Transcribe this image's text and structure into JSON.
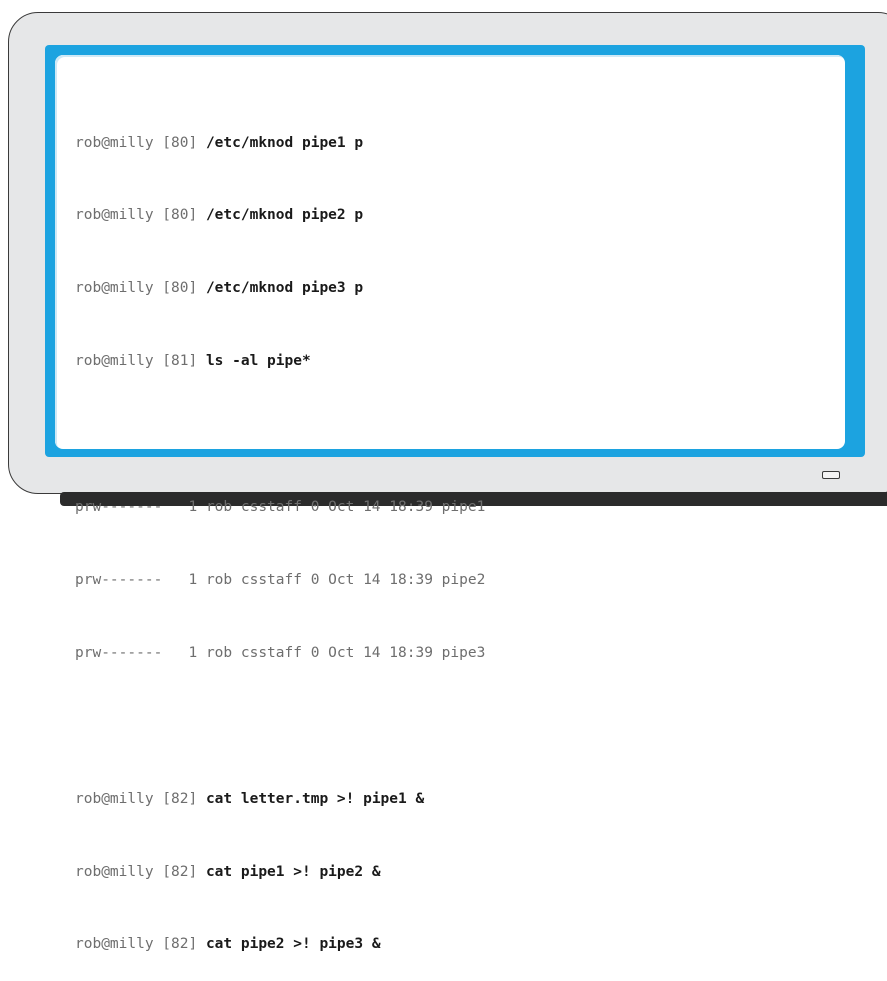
{
  "terminal": {
    "session1": [
      {
        "prompt": "rob@milly [80] ",
        "command": "/etc/mknod pipe1 p"
      },
      {
        "prompt": "rob@milly [80] ",
        "command": "/etc/mknod pipe2 p"
      },
      {
        "prompt": "rob@milly [80] ",
        "command": "/etc/mknod pipe3 p"
      },
      {
        "prompt": "rob@milly [81] ",
        "command": "ls -al pipe*"
      }
    ],
    "listing": [
      "prw-------   1 rob csstaff 0 Oct 14 18:39 pipe1",
      "prw-------   1 rob csstaff 0 Oct 14 18:39 pipe2",
      "prw-------   1 rob csstaff 0 Oct 14 18:39 pipe3"
    ],
    "session2": [
      {
        "prompt": "rob@milly [82] ",
        "command": "cat letter.tmp >! pipe1 &"
      },
      {
        "prompt": "rob@milly [82] ",
        "command": "cat pipe1 >! pipe2 &"
      },
      {
        "prompt": "rob@milly [82] ",
        "command": "cat pipe2 >! pipe3 &"
      }
    ]
  },
  "colors": {
    "bezel": "#1ca3e0",
    "monitor_body": "#e6e7e8",
    "command_text": "#1a1a1a",
    "output_text": "#6e6e6e"
  }
}
